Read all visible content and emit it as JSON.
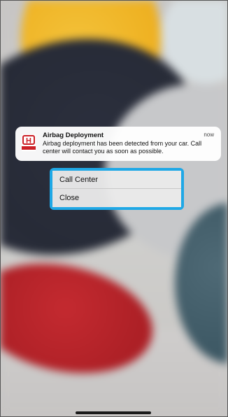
{
  "notification": {
    "app_icon": "honda-logo-icon",
    "title": "Airbag Deployment",
    "time": "now",
    "body": "Airbag deployment has been detected from your car. Call center will contact you as soon as possible."
  },
  "actions": {
    "items": [
      {
        "label": "Call Center"
      },
      {
        "label": "Close"
      }
    ],
    "highlight_color": "#1fa8e6"
  },
  "colors": {
    "brand_red": "#cc1f26"
  }
}
